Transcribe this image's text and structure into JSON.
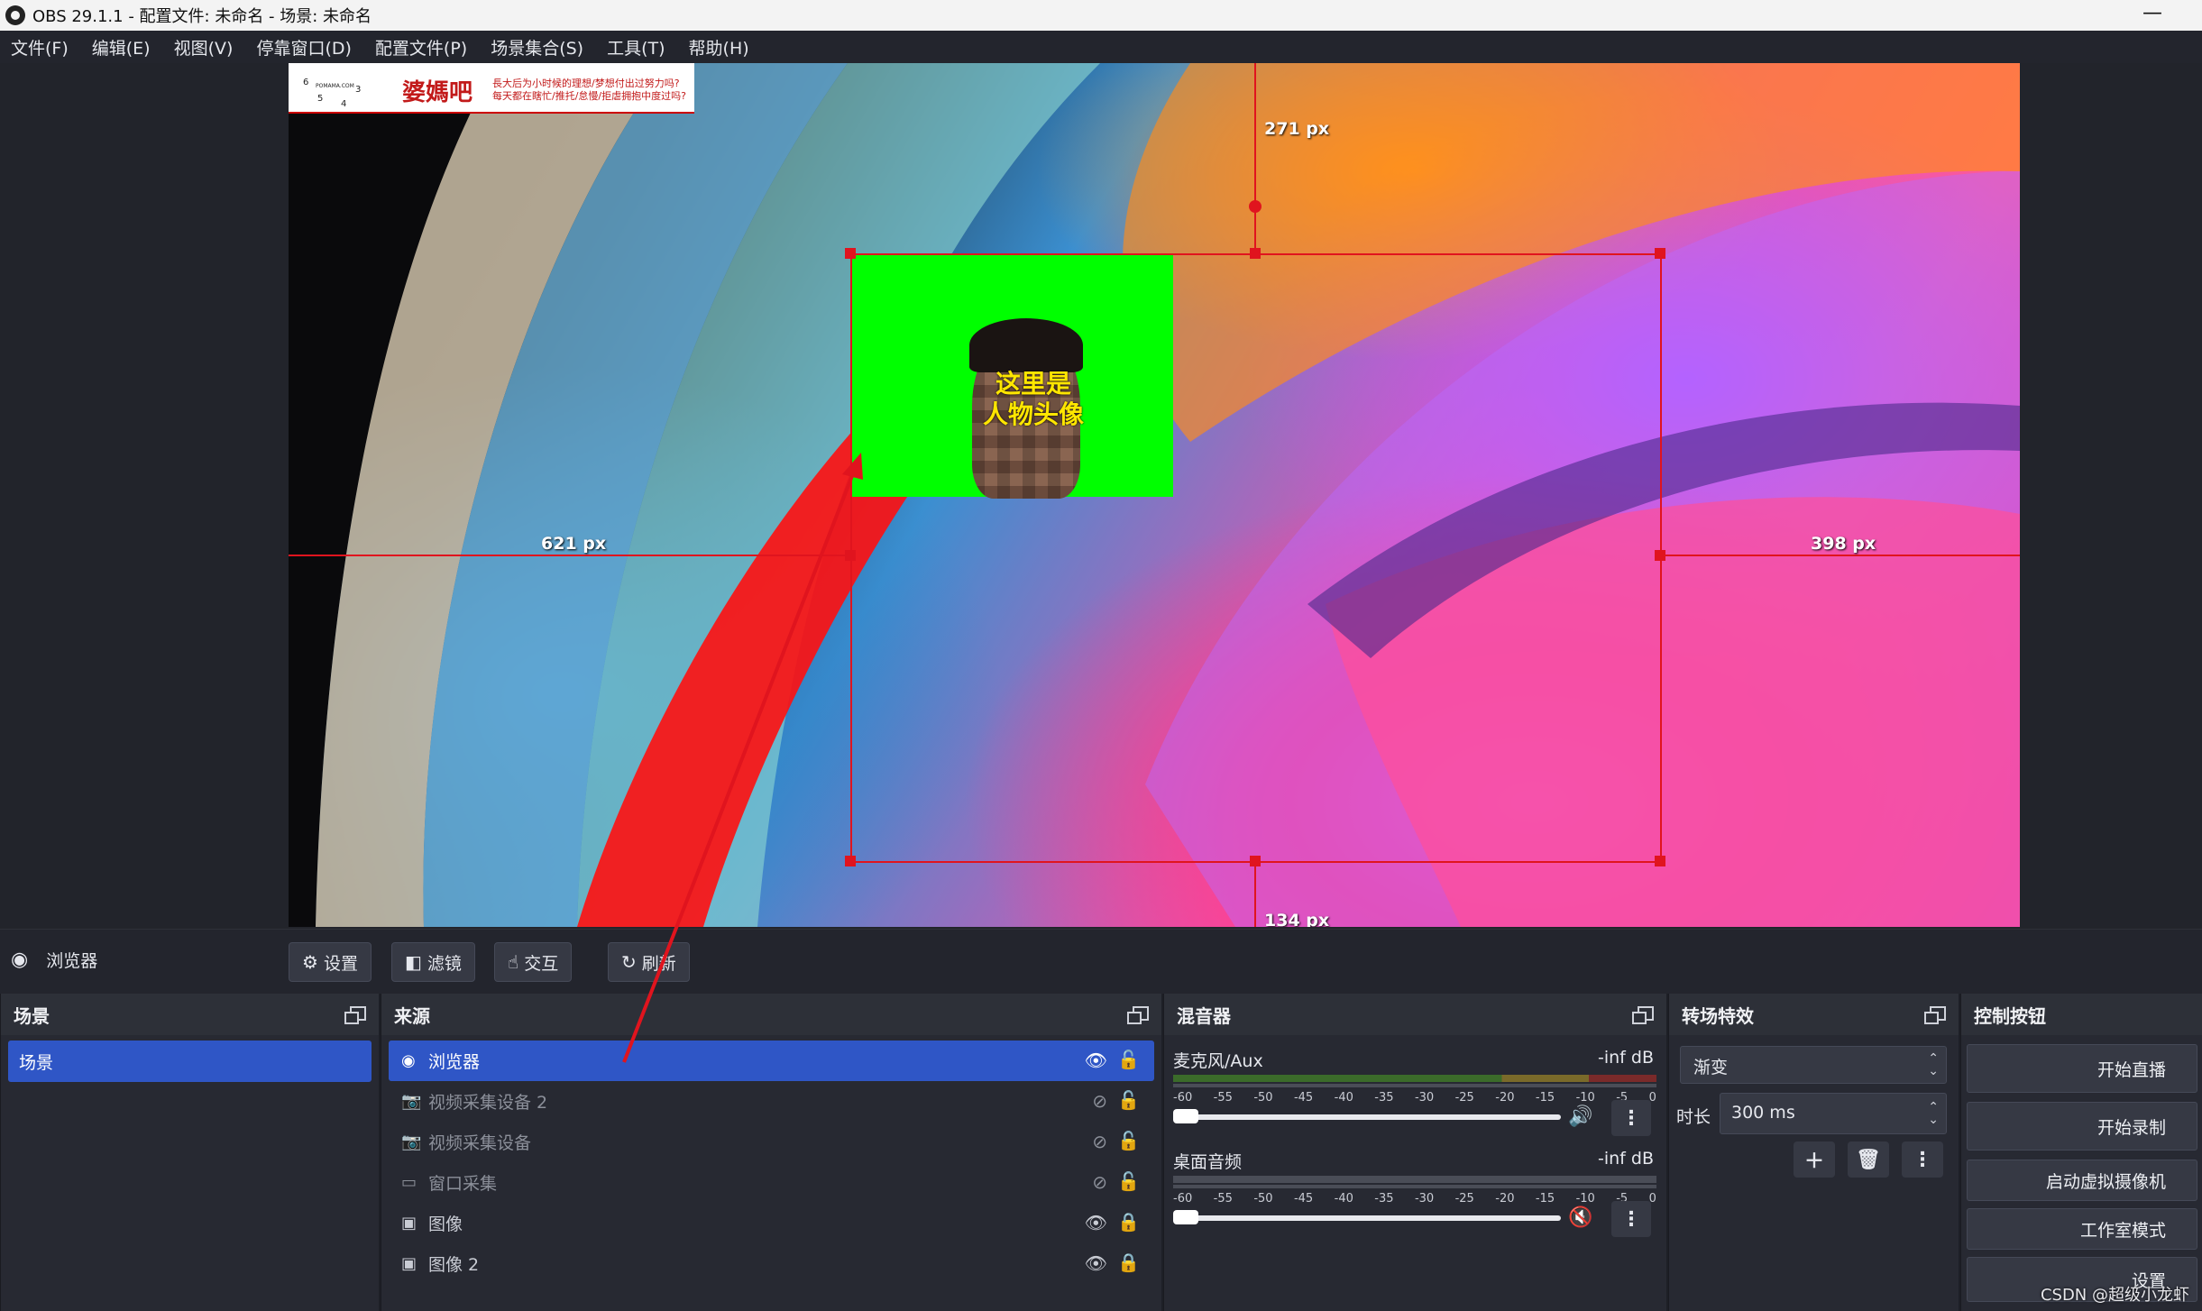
{
  "titlebar": {
    "title": "OBS 29.1.1 - 配置文件: 未命名 - 场景: 未命名",
    "minimize": "—"
  },
  "menu": [
    "文件(F)",
    "编辑(E)",
    "视图(V)",
    "停靠窗口(D)",
    "配置文件(P)",
    "场景集合(S)",
    "工具(T)",
    "帮助(H)"
  ],
  "preview": {
    "banner_main": "婆媽吧",
    "banner_sub": "長大后为小时候的理想/梦想付出过努力吗? 每天都在瞎忙/推托/怠慢/拒虐拥抱中度过吗?",
    "banner_clock_brand": "POMAMA.COM",
    "banner_clock_numbers": [
      "6",
      "3",
      "5",
      "4"
    ],
    "face_label_line1": "这里是",
    "face_label_line2": "人物头像",
    "distance_top": "271 px",
    "distance_left": "621 px",
    "distance_right": "398 px",
    "distance_bottom": "134 px"
  },
  "context_bar": {
    "source_name": "浏览器",
    "buttons": [
      "设置",
      "滤镜",
      "交互",
      "刷新"
    ]
  },
  "scenes": {
    "title": "场景",
    "items": [
      "场景"
    ]
  },
  "sources": {
    "title": "来源",
    "items": [
      {
        "name": "浏览器",
        "icon": "globe-icon",
        "visible": true,
        "active": true
      },
      {
        "name": "视频采集设备 2",
        "icon": "camera-icon",
        "visible": false,
        "active": false
      },
      {
        "name": "视频采集设备",
        "icon": "camera-icon",
        "visible": false,
        "active": false
      },
      {
        "name": "窗口采集",
        "icon": "window-icon",
        "visible": false,
        "active": false
      },
      {
        "name": "图像",
        "icon": "image-icon",
        "visible": true,
        "active": false
      },
      {
        "name": "图像 2",
        "icon": "image-icon",
        "visible": true,
        "active": false
      }
    ]
  },
  "mixer": {
    "title": "混音器",
    "scale": [
      "-60",
      "-55",
      "-50",
      "-45",
      "-40",
      "-35",
      "-30",
      "-25",
      "-20",
      "-15",
      "-10",
      "-5",
      "0"
    ],
    "channels": [
      {
        "name": "麦克风/Aux",
        "db": "-inf dB",
        "muted": false
      },
      {
        "name": "桌面音频",
        "db": "-inf dB",
        "muted": true
      }
    ]
  },
  "transitions": {
    "title": "转场特效",
    "selected": "渐变",
    "duration_label": "时长",
    "duration_value": "300 ms"
  },
  "controls": {
    "title": "控制按钮",
    "buttons": [
      "开始直播",
      "开始录制",
      "启动虚拟摄像机",
      "工作室模式",
      "设置"
    ]
  },
  "watermark": "CSDN @超级小龙虾",
  "colors": {
    "accent": "#2f56c6",
    "guide_red": "#e0141e",
    "green_screen": "#00ff00"
  }
}
